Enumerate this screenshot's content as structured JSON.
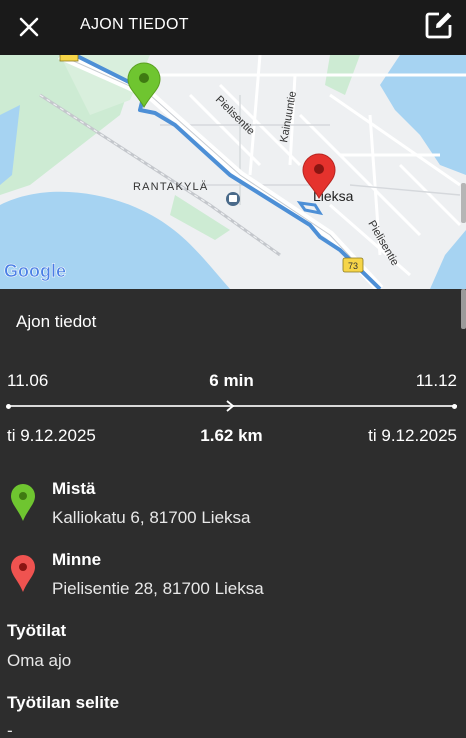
{
  "header": {
    "title": "AJON TIEDOT",
    "close_icon": "close-icon",
    "edit_icon": "edit-icon"
  },
  "map": {
    "labels": {
      "pielisentie_1": "Pielisentie",
      "kainuuntie": "Kainuuntie",
      "rantakyla": "RANTAKYLÄ",
      "lieksa": "Lieksa",
      "pielisentie_2": "Pielisentie",
      "road_73": "73"
    },
    "attribution": "Google",
    "colors": {
      "water": "#a6d3f2",
      "land": "#eef0f2",
      "green": "#cdebd3",
      "route": "#4d8fd6",
      "start_pin": "#6fc530",
      "end_pin": "#e5322d"
    }
  },
  "details": {
    "section_title": "Ajon tiedot",
    "start_time": "11.06",
    "duration": "6 min",
    "end_time": "11.12",
    "start_date": "ti 9.12.2025",
    "distance": "1.62 km",
    "end_date": "ti 9.12.2025",
    "from": {
      "label": "Mistä",
      "address": "Kalliokatu 6, 81700 Lieksa",
      "pin_color": "#6fc530"
    },
    "to": {
      "label": "Minne",
      "address": "Pielisentie 28, 81700 Lieksa",
      "pin_color": "#ef5350"
    },
    "worksite": {
      "label": "Työtilat",
      "value": "Oma ajo"
    },
    "worksite_note": {
      "label": "Työtilan selite",
      "value": "-"
    }
  }
}
